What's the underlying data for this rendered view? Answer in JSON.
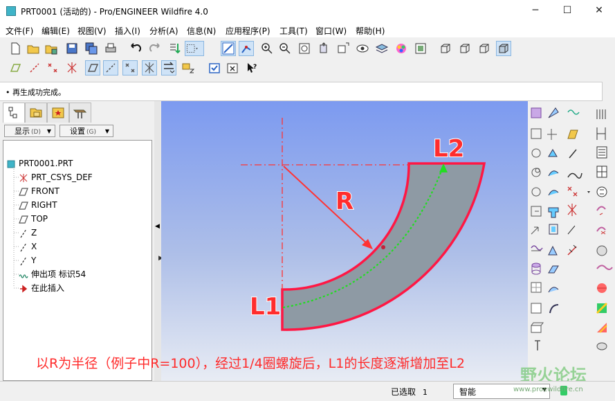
{
  "window": {
    "title": "PRT0001 (活动的) - Pro/ENGINEER Wildfire 4.0",
    "minimize": "─",
    "maximize": "☐",
    "close": "✕"
  },
  "menu": [
    "文件(F)",
    "编辑(E)",
    "视图(V)",
    "插入(I)",
    "分析(A)",
    "信息(N)",
    "应用程序(P)",
    "工具(T)",
    "窗口(W)",
    "帮助(H)"
  ],
  "message": "• 再生成功完成。",
  "leftpanel": {
    "show_label": "显示",
    "show_key": "(D)",
    "settings_label": "设置",
    "settings_key": "(G)",
    "tree": [
      {
        "label": "PRT0001.PRT",
        "icon": "part-icon"
      },
      {
        "label": "PRT_CSYS_DEF",
        "icon": "csys-icon"
      },
      {
        "label": "FRONT",
        "icon": "datum-plane-icon"
      },
      {
        "label": "RIGHT",
        "icon": "datum-plane-icon"
      },
      {
        "label": "TOP",
        "icon": "datum-plane-icon"
      },
      {
        "label": "Z",
        "icon": "datum-axis-icon"
      },
      {
        "label": "X",
        "icon": "datum-axis-icon"
      },
      {
        "label": "Y",
        "icon": "datum-axis-icon"
      },
      {
        "label": "伸出项 标识54",
        "icon": "protrusion-icon"
      },
      {
        "label": "在此插入",
        "icon": "insert-here-arrow-icon"
      }
    ]
  },
  "viewport": {
    "labels": {
      "l1": "L1",
      "l2": "L2",
      "r": "R"
    },
    "colors": {
      "outline": "#ff1744",
      "fill": "#8e9aa4",
      "path": "#22dd22",
      "radius": "#ff3333"
    }
  },
  "caption": "以R为半径（例子中R=100），经过1/4圈螺旋后，L1的长度逐渐增加至L2",
  "status": {
    "selected_label": "已选取",
    "selected_count": "1",
    "filter": "智能"
  },
  "watermark": {
    "main": "野火论坛",
    "url": "www.proewildfire.cn"
  }
}
